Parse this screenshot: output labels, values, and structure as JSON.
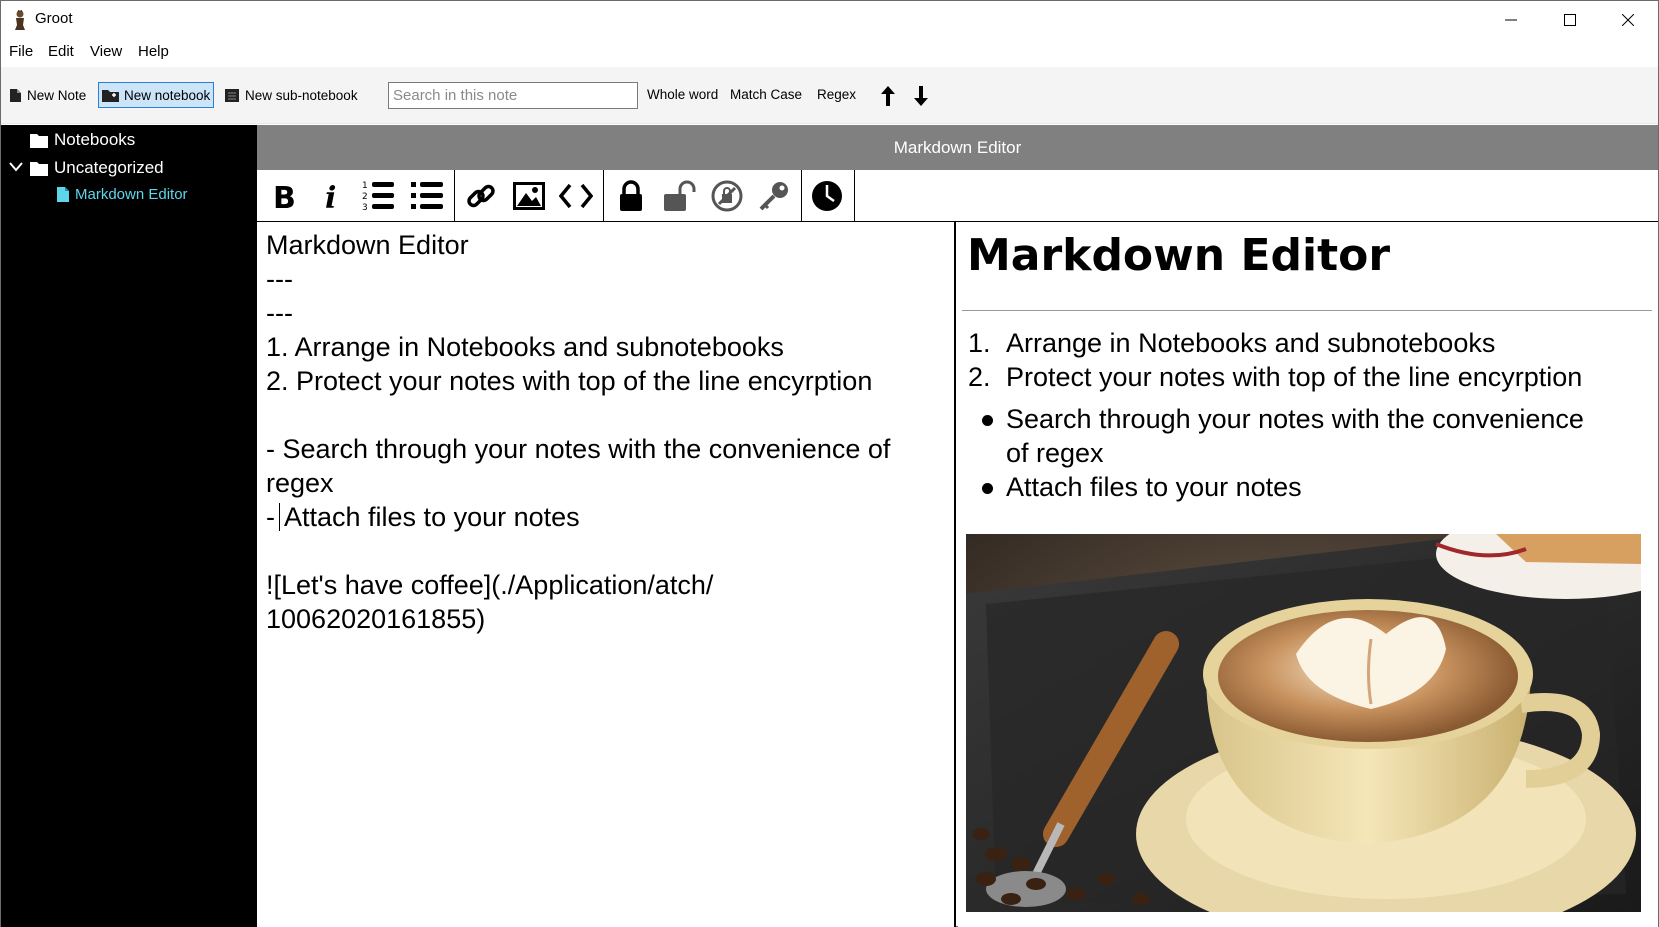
{
  "window": {
    "title": "Groot",
    "controls": [
      "minimize-icon",
      "maximize-icon",
      "close-icon"
    ]
  },
  "menu": {
    "items": [
      "File",
      "Edit",
      "View",
      "Help"
    ]
  },
  "toolbar": {
    "new_note": "New Note",
    "new_notebook": "New notebook",
    "new_sub_notebook": "New sub-notebook",
    "search_placeholder": "Search in this note",
    "search_value": "",
    "whole_word": "Whole word",
    "match_case": "Match Case",
    "regex": "Regex",
    "active_button": "new_notebook"
  },
  "sidebar": {
    "items": [
      {
        "label": "Notebooks",
        "icon": "folder-icon"
      },
      {
        "label": "Uncategorized",
        "icon": "folder-icon",
        "expanded": true
      },
      {
        "label": "Markdown Editor",
        "icon": "note-icon",
        "selected": true
      }
    ]
  },
  "editor": {
    "header": "Markdown Editor",
    "format_buttons": [
      "bold-icon",
      "italic-icon",
      "numbered-list-icon",
      "bullet-list-icon",
      "link-icon",
      "image-icon",
      "code-icon",
      "lock-icon",
      "unlock-icon",
      "decrypt-icon",
      "key-icon",
      "clock-icon"
    ],
    "source_lines": [
      "Markdown Editor",
      "---",
      "---",
      "1. Arrange in Notebooks and subnotebooks",
      "2. Protect your notes with top of the line encyrption",
      "",
      "- Search through your notes with the convenience of regex",
      "- Attach files to your notes",
      "",
      "![Let's have coffee](./Application/atch/",
      "10062020161855)"
    ]
  },
  "preview": {
    "title": "Markdown Editor",
    "ordered": [
      "Arrange in Notebooks and subnotebooks",
      "Protect your notes with top of the line encyrption"
    ],
    "bullets": [
      "Search through your notes with the convenience of regex",
      "Attach files to your notes"
    ],
    "image_alt": "Let's have coffee"
  },
  "colors": {
    "sidebar_bg": "#000000",
    "sidebar_selected": "#5dd6ea",
    "header_bg": "#808080",
    "toolbar_bg": "#f4f4f4",
    "active_btn": "#cce4f7"
  }
}
